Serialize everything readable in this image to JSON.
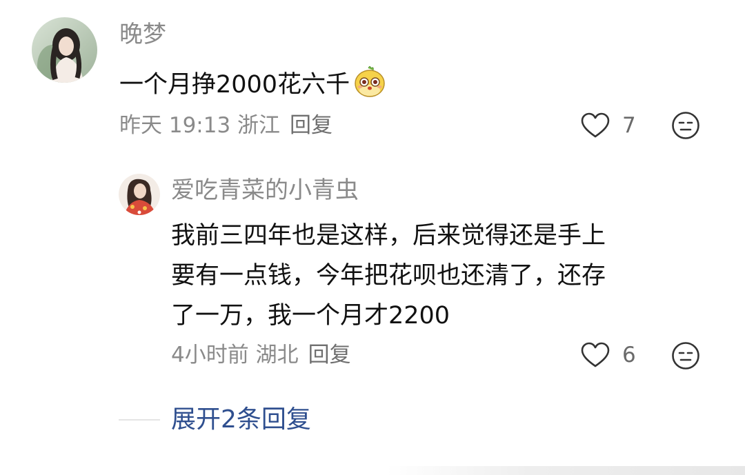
{
  "comment": {
    "username": "晚梦",
    "text": "一个月挣2000花六千",
    "emoji": "yellow-blob-sticker",
    "meta": {
      "time": "昨天 19:13 浙江",
      "reply": "回复"
    },
    "likes": "7"
  },
  "reply": {
    "username": "爱吃青菜的小青虫",
    "text_lines": [
      "我前三四年也是这样，后来觉得还是手上",
      "要有一点钱，今年把花呗也还清了，还存",
      "了一万，我一个月才2200"
    ],
    "meta": {
      "time": "4小时前 湖北",
      "reply": "回复"
    },
    "likes": "6"
  },
  "expand_replies": "展开2条回复"
}
